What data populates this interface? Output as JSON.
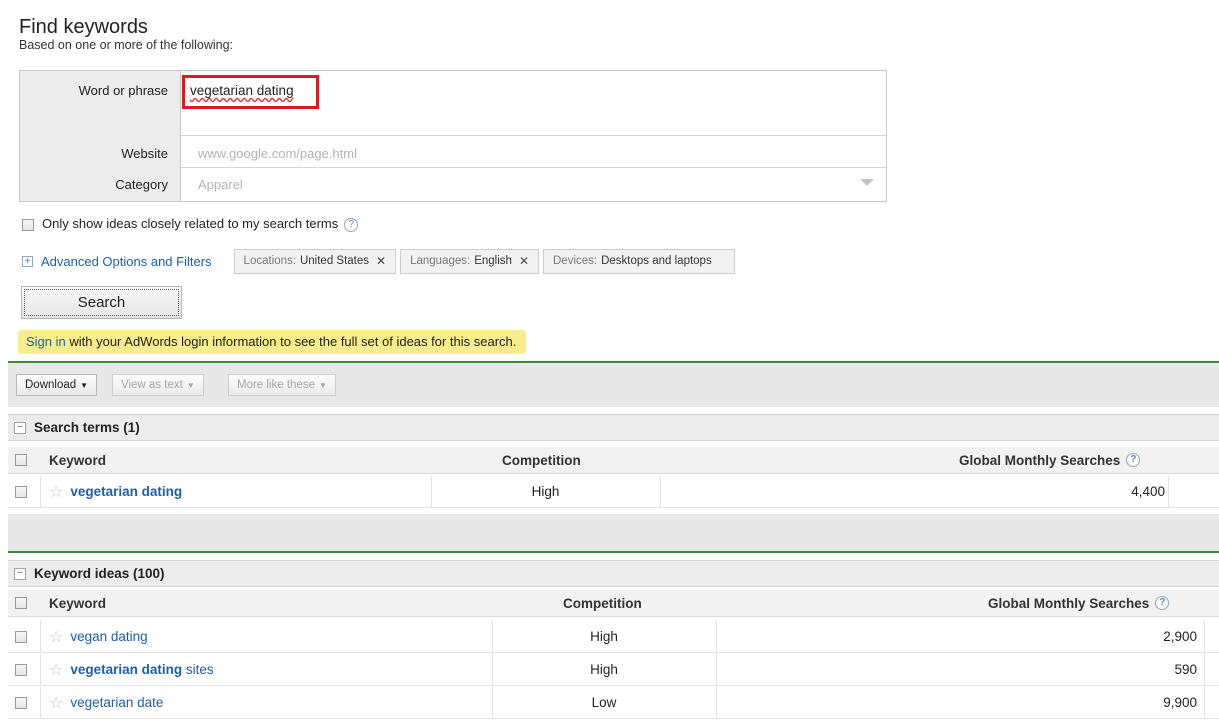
{
  "header": {
    "title": "Find keywords",
    "subtitle": "Based on one or more of the following:"
  },
  "form": {
    "word_label": "Word or phrase",
    "word_value": "vegetarian dating",
    "website_label": "Website",
    "website_placeholder": "www.google.com/page.html",
    "category_label": "Category",
    "category_placeholder": "Apparel"
  },
  "options": {
    "only_show_label": "Only show ideas closely related to my search terms",
    "help_glyph": "?",
    "advanced_label": "Advanced Options and Filters",
    "chips": [
      {
        "key": "Locations:",
        "value": "United States",
        "x": "✕"
      },
      {
        "key": "Languages:",
        "value": "English",
        "x": "✕"
      },
      {
        "key": "Devices:",
        "value": "Desktops and laptops"
      }
    ]
  },
  "search_button": "Search",
  "signin": {
    "link": "Sign in",
    "text": " with your AdWords login information to see the full set of ideas for this search."
  },
  "toolbar": {
    "download": "Download",
    "view_as_text": "View as text",
    "more_like_these": "More like these"
  },
  "search_terms": {
    "title": "Search terms (1)",
    "columns": {
      "keyword": "Keyword",
      "competition": "Competition",
      "searches": "Global Monthly Searches"
    },
    "rows": [
      {
        "keyword_bold": "vegetarian dating",
        "keyword_rest": "",
        "competition": "High",
        "searches": "4,400"
      }
    ]
  },
  "keyword_ideas": {
    "title": "Keyword ideas (100)",
    "columns": {
      "keyword": "Keyword",
      "competition": "Competition",
      "searches": "Global Monthly Searches"
    },
    "rows": [
      {
        "keyword_bold": "",
        "keyword_rest": "vegan dating",
        "competition": "High",
        "searches": "2,900"
      },
      {
        "keyword_bold": "vegetarian dating",
        "keyword_rest": " sites",
        "competition": "High",
        "searches": "590"
      },
      {
        "keyword_bold": "",
        "keyword_rest": "vegetarian date",
        "competition": "Low",
        "searches": "9,900"
      }
    ]
  },
  "colors": {
    "link": "#1e5fa6",
    "highlight_border": "#d21d22",
    "signin_bg": "#f9ed8b",
    "green_rule": "#3a8a3a"
  },
  "icons": [
    "help-icon",
    "plus-icon",
    "minus-icon",
    "star-icon",
    "chevron-down-icon",
    "close-icon"
  ]
}
